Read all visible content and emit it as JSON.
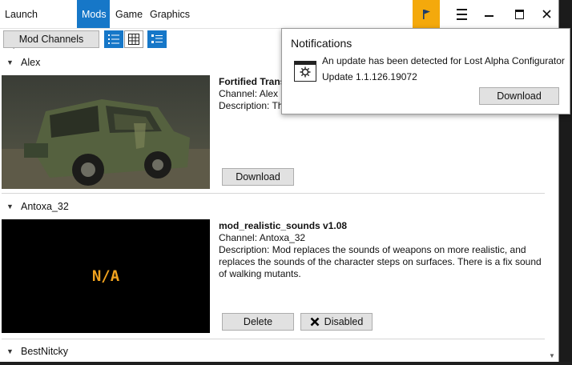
{
  "menu": {
    "tabs": [
      {
        "label": "Launch Options",
        "active": false
      },
      {
        "label": "Mods",
        "active": true
      },
      {
        "label": "Game",
        "active": false
      },
      {
        "label": "Graphics",
        "active": false
      }
    ]
  },
  "colors": {
    "accent": "#1677c8",
    "flag": "#f4a90c",
    "na_text": "#f0a21e"
  },
  "toolbar": {
    "mod_channels_label": "Mod Channels"
  },
  "groups": [
    {
      "name": "Alex",
      "mod": {
        "title": "Fortified Transport",
        "channel": "Channel: Alex",
        "description": "Description: Th",
        "button": "Download"
      }
    },
    {
      "name": "Antoxa_32",
      "mod": {
        "title": "mod_realistic_sounds v1.08",
        "channel": "Channel: Antoxa_32",
        "description": "Description: Mod replaces the sounds of weapons on more realistic, and replaces the sounds of the character steps on surfaces. There is a fix sound of walking mutants.",
        "thumb_text": "N/A",
        "delete_button": "Delete",
        "disabled_button": "Disabled"
      }
    },
    {
      "name": "BestNitcky"
    }
  ],
  "notifications": {
    "title": "Notifications",
    "message": "An update has been detected for Lost Alpha Configurator",
    "version": "Update 1.1.126.19072",
    "button": "Download"
  }
}
